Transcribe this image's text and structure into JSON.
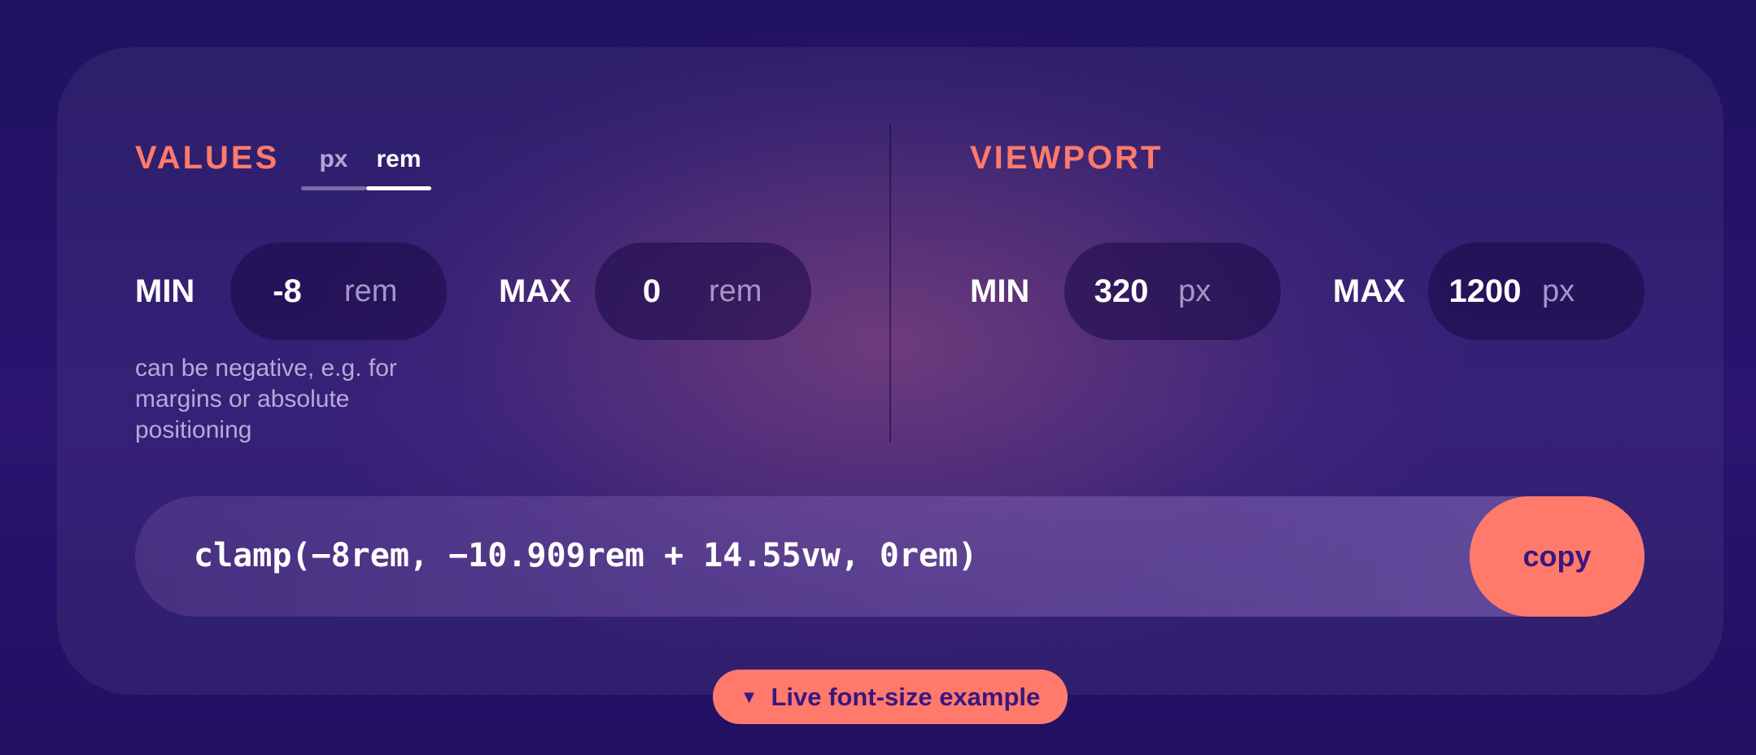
{
  "values": {
    "title": "VALUES",
    "units": [
      {
        "label": "px",
        "active": false
      },
      {
        "label": "rem",
        "active": true
      }
    ],
    "min": {
      "label": "MIN",
      "value": "-8",
      "unit": "rem"
    },
    "max": {
      "label": "MAX",
      "value": "0",
      "unit": "rem"
    },
    "hint": "can be negative, e.g. for margins or absolute positioning"
  },
  "viewport": {
    "title": "VIEWPORT",
    "min": {
      "label": "MIN",
      "value": "320",
      "unit": "px"
    },
    "max": {
      "label": "MAX",
      "value": "1200",
      "unit": "px"
    }
  },
  "output": {
    "code": "clamp(−8rem, −10.909rem + 14.55vw, 0rem)",
    "copy_label": "copy"
  },
  "example_toggle": {
    "icon": "triangle-down-icon",
    "label": "Live font-size example"
  },
  "colors": {
    "accent": "#ff7a6b",
    "background": "#1f1160",
    "button_text": "#3a1680"
  }
}
